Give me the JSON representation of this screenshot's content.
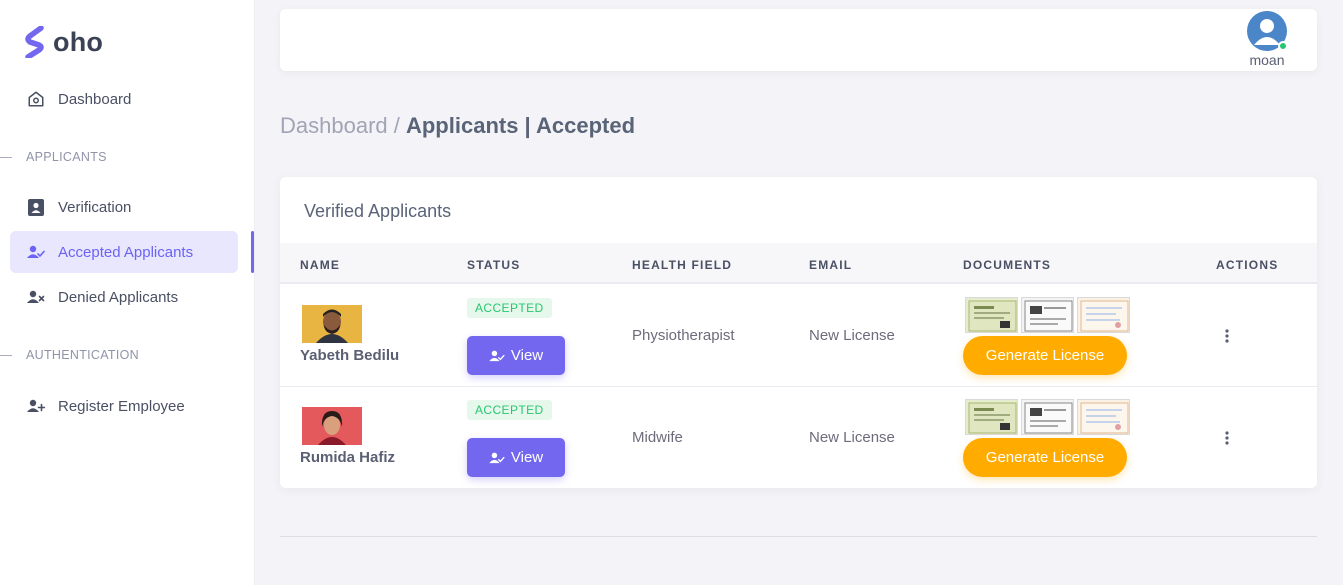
{
  "brand": {
    "name": "oho"
  },
  "sidebar": {
    "dashboard_label": "Dashboard",
    "sections": {
      "applicants": "APPLICANTS",
      "authentication": "AUTHENTICATION"
    },
    "items": [
      {
        "label": "Verification",
        "icon": "id-card-icon"
      },
      {
        "label": "Accepted Applicants",
        "icon": "user-check-icon",
        "active": true
      },
      {
        "label": "Denied Applicants",
        "icon": "user-x-icon"
      },
      {
        "label": "Register Employee",
        "icon": "user-plus-icon"
      }
    ]
  },
  "topbar": {
    "user_name": "moan",
    "status": "online"
  },
  "breadcrumb": {
    "parent": "Dashboard",
    "separator": " / ",
    "current": "Applicants | Accepted"
  },
  "card": {
    "title": "Verified Applicants",
    "columns": {
      "name": "NAME",
      "status": "STATUS",
      "health_field": "HEALTH FIELD",
      "email": "EMAIL",
      "documents": "DOCUMENTS",
      "actions": "ACTIONS"
    },
    "rows": [
      {
        "name": "Yabeth Bedilu",
        "status": "ACCEPTED",
        "view_label": "View",
        "health_field": "Physiotherapist",
        "email": "New License",
        "generate_label": "Generate License"
      },
      {
        "name": "Rumida Hafiz",
        "status": "ACCEPTED",
        "view_label": "View",
        "health_field": "Midwife",
        "email": "New License",
        "generate_label": "Generate License"
      }
    ]
  },
  "colors": {
    "primary": "#7367f0",
    "warning": "#ffab00",
    "success": "#28c76f"
  }
}
